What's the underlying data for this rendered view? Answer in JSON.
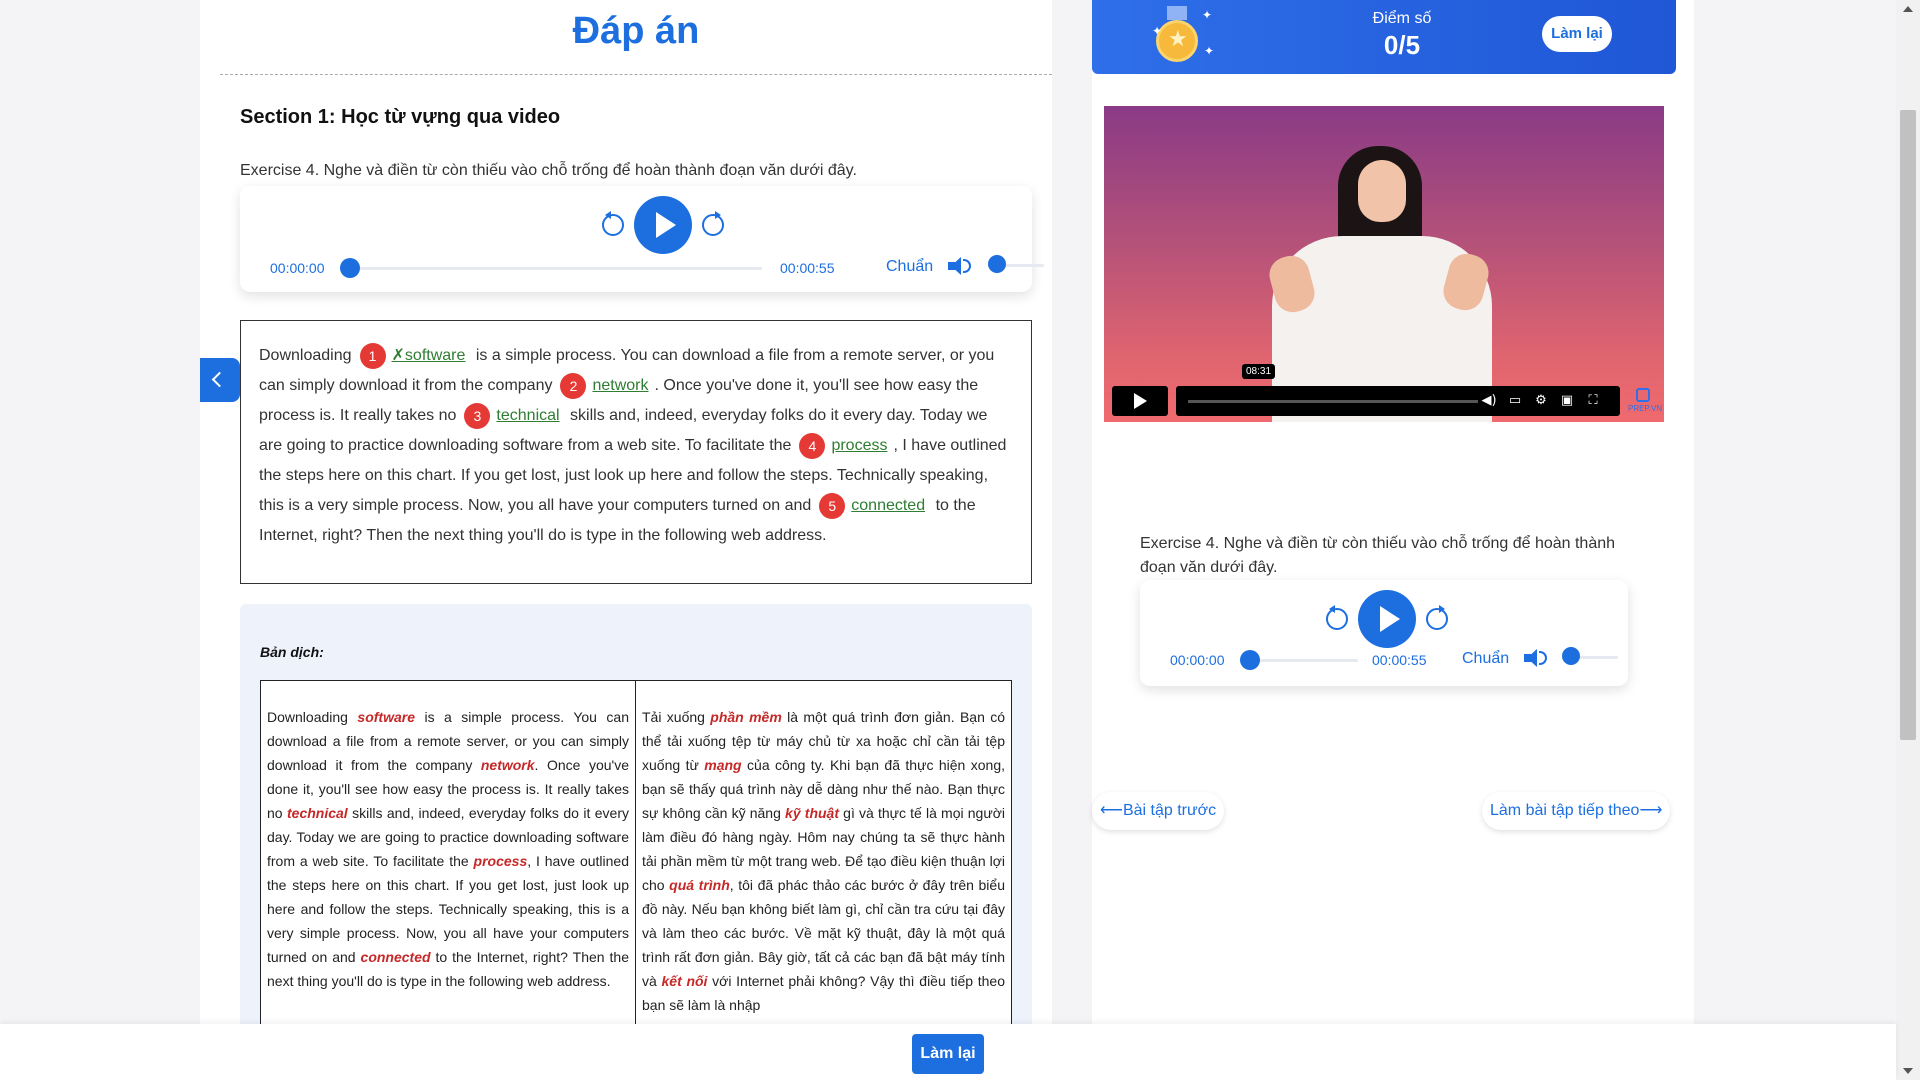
{
  "answer_page": {
    "title": "Đáp án",
    "section_title": "Section 1: Học từ vựng qua video",
    "exercise_instruction": "Exercise 4. Nghe và điền từ còn thiếu vào chỗ trống để hoàn thành đoạn văn dưới đây.",
    "audio": {
      "current_time": "00:00:00",
      "duration": "00:00:55",
      "speed": "Chuẩn",
      "progress": 0
    },
    "passage": {
      "p1": "Downloading",
      "n1": "1",
      "a1": "✗software",
      "p2": "is a simple process. You can download a file from a remote server, or you can simply download it from the company",
      "n2": "2",
      "a2": "network",
      "p3": ". Once you've done it, you'll see how easy the process is. It really takes no",
      "n3": "3",
      "a3": "technical",
      "p4": "skills and, indeed, everyday folks do it every day. Today we are going to practice downloading software from a web site. To facilitate the",
      "n4": "4",
      "a4": "process",
      "p5": ", I have outlined the steps here on this chart. If you get lost, just look up here and follow the steps. Technically speaking, this is a very simple process. Now, you all have your computers turned on and",
      "n5": "5",
      "a5": "connected",
      "p6": "to the Internet, right? Then the next thing you'll do is type in the following web address."
    },
    "translation": {
      "label": "Bản dịch:",
      "en": {
        "t1": "Downloading ",
        "h1": "software",
        "t2": " is a simple process. You can download a file from a remote server, or you can simply download it from the company ",
        "h2": "network",
        "t3": ". Once you've done it, you'll see how easy the process is. It really takes no ",
        "h3": "technical",
        "t4": " skills and, indeed, everyday folks do it every day. Today we are going to practice downloading software from a web site. To facilitate the ",
        "h4": "process",
        "t5": ", I have outlined the steps here on this chart. If you get lost, just look up here and follow the steps. Technically speaking, this is a very simple process. Now, you all have your computers turned on and ",
        "h5": "connected",
        "t6": " to the Internet, right? Then the next thing you'll do is type in the following web address."
      },
      "vi": {
        "t1": "Tải xuống ",
        "h1": "phần mềm",
        "t2": " là một quá trình đơn giản. Bạn có thể tải xuống tệp từ máy chủ từ xa hoặc chỉ cần tải tệp xuống từ ",
        "h2": "mạng",
        "t3": " của công ty. Khi bạn đã thực hiện xong, bạn sẽ thấy quá trình này dễ dàng như thế nào. Bạn thực sự không cần kỹ năng ",
        "h3": "kỹ thuật",
        "t4": " gì và thực tế là mọi người làm điều đó hàng ngày. Hôm nay chúng ta sẽ thực hành tải phần mềm từ một trang web. Để tạo điều kiện thuận lợi cho ",
        "h4": "quá trình",
        "t5": ", tôi đã phác thảo các bước ở đây trên biểu đồ này. Nếu bạn không biết làm gì, chỉ cần tra cứu tại đây và làm theo các bước. Về mặt kỹ thuật, đây là một quá trình rất đơn giản. Bây giờ, tất cả các bạn đã bật máy tính và ",
        "h5": "kết nối",
        "t6": " với Internet phải không? Vậy thì điều tiếp theo bạn sẽ làm là nhập"
      }
    }
  },
  "score": {
    "label": "Điểm số",
    "value": "0/5",
    "retry": "Làm lại"
  },
  "video": {
    "duration_tooltip": "08:31",
    "logo_text": "PREP.VN"
  },
  "side_exercise": {
    "instruction": "Exercise 4. Nghe và điền từ còn thiếu vào chỗ trống để hoàn thành đoạn văn dưới đây.",
    "audio": {
      "current_time": "00:00:00",
      "duration": "00:00:55",
      "speed": "Chuẩn",
      "progress": 0
    }
  },
  "navigation": {
    "prev": "⟵Bài tập trước",
    "next": "Làm bài tập tiếp theo⟶"
  },
  "footer": {
    "retry": "Làm lại"
  },
  "colors": {
    "accent": "#1d6fe0",
    "answer_number": "#e53935",
    "answer_word": "#2e7d32",
    "translation_highlight": "#c62828"
  }
}
